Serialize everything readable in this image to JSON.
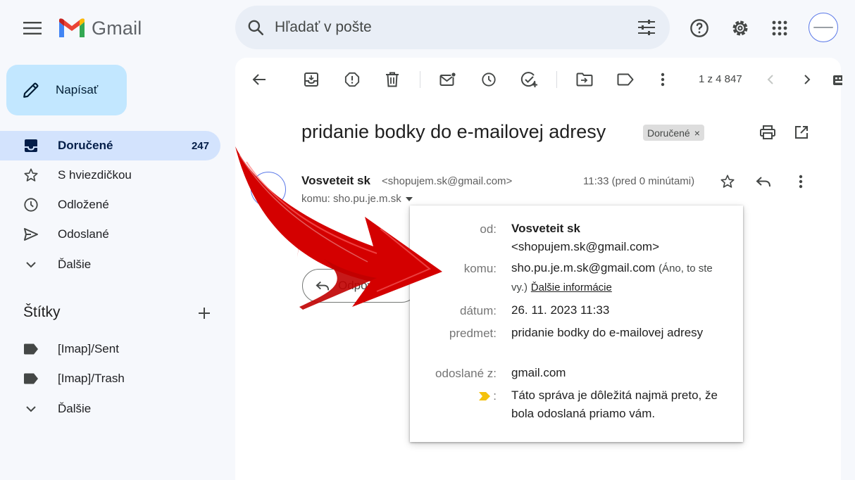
{
  "app": {
    "name": "Gmail"
  },
  "search": {
    "placeholder": "Hľadať v pošte"
  },
  "compose": {
    "label": "Napísať"
  },
  "nav": [
    {
      "label": "Doručené",
      "count": "247",
      "icon": "inbox-icon",
      "active": true
    },
    {
      "label": "S hviezdičkou",
      "icon": "star-icon"
    },
    {
      "label": "Odložené",
      "icon": "clock-icon"
    },
    {
      "label": "Odoslané",
      "icon": "send-icon"
    },
    {
      "label": "Ďalšie",
      "icon": "chevron-down-icon"
    }
  ],
  "labels": {
    "title": "Štítky",
    "items": [
      {
        "label": "[Imap]/Sent",
        "icon": "label-icon"
      },
      {
        "label": "[Imap]/Trash",
        "icon": "label-icon"
      },
      {
        "label": "Ďalšie",
        "icon": "chevron-down-icon"
      }
    ]
  },
  "toolbar": {
    "pager": "1 z 4 847"
  },
  "message": {
    "subject": "pridanie bodky do e-mailovej adresy",
    "chip": "Doručené",
    "sender_name": "Vosveteit sk",
    "sender_email": "<shopujem.sk@gmail.com>",
    "to": "komu: sho.pu.je.m.sk",
    "time": "11:33 (pred 0 minútami)",
    "reply_label": "Odpovedať"
  },
  "details": {
    "from_key": "od:",
    "from_name": "Vosveteit sk",
    "from_email": "<shopujem.sk@gmail.com>",
    "to_key": "komu:",
    "to_value": "sho.pu.je.m.sk@gmail.com",
    "to_note": "(Áno, to ste vy.)",
    "to_link": "Ďalšie informácie",
    "date_key": "dátum:",
    "date_value": "26. 11. 2023 11:33",
    "subject_key": "predmet:",
    "subject_value": "pridanie bodky do e-mailovej adresy",
    "sentby_key": "odoslané z:",
    "sentby_value": "gmail.com",
    "important_key": ":",
    "important_value": "Táto správa je dôležitá najmä preto, že bola odoslaná priamo vám."
  },
  "colors": {
    "accent": "#0b57d0",
    "compose_bg": "#c2e7ff",
    "active_nav": "#d3e3fd",
    "arrow": "#d40000",
    "important": "#f4c20d"
  }
}
